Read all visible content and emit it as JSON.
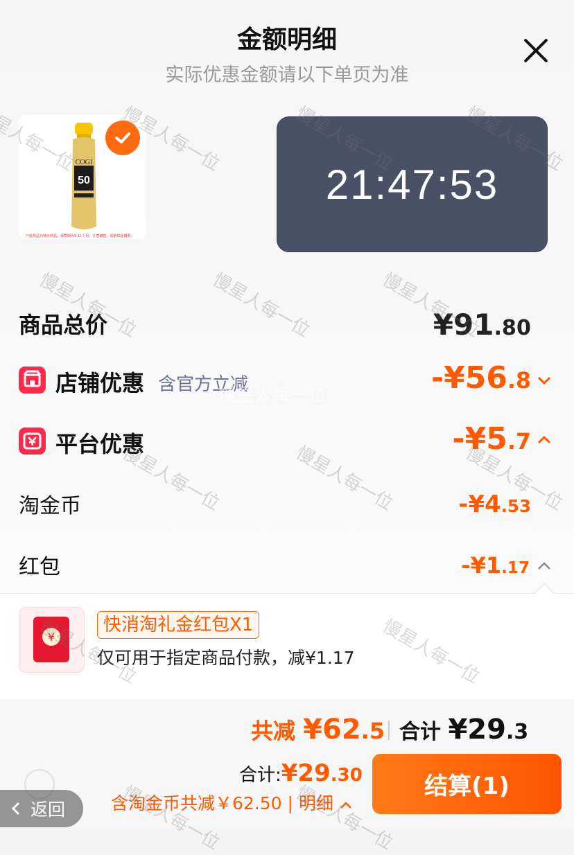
{
  "header": {
    "title": "金额明细",
    "subtitle": "实际优惠金额请以下单页为准"
  },
  "product": {
    "brand": "COGI",
    "spf": "50",
    "note": "**此商品为特价商品，保质期为9-11个月，介意慎拍，请悉知此期限。"
  },
  "timer": "21:47:53",
  "rows": {
    "total": {
      "label": "商品总价",
      "price_int": "¥91",
      "price_dec": ".80"
    },
    "shop": {
      "label": "店铺优惠",
      "note": "含官方立减",
      "price_int": "-¥56",
      "price_dec": ".8"
    },
    "platform": {
      "label": "平台优惠",
      "price_int": "-¥5",
      "price_dec": ".7"
    },
    "coins": {
      "label": "淘金币",
      "price_int": "-¥4",
      "price_dec": ".53"
    },
    "redpacket": {
      "label": "红包",
      "price_int": "-¥1",
      "price_dec": ".17"
    }
  },
  "coupon": {
    "tag": "快消淘礼金红包X1",
    "desc": "仅可用于指定商品付款，减¥1.17",
    "coin_symbol": "¥"
  },
  "summary": {
    "cut_label": "共减",
    "cut_int": "¥62",
    "cut_dec": ".5",
    "sum_label": "合计",
    "sum_int": "¥29",
    "sum_dec": ".3",
    "sum2_label": "合计:",
    "sum2_int": "¥29",
    "sum2_dec": ".30",
    "coin_line": "含淘金币共减￥62.50 | 明细"
  },
  "checkout_label": "结算(1)",
  "back_label": "返回",
  "watermark": "慢星人每一位",
  "colors": {
    "accent": "#ff5a00",
    "timer_bg": "#4a5065",
    "badge": "#ff2a4a"
  }
}
